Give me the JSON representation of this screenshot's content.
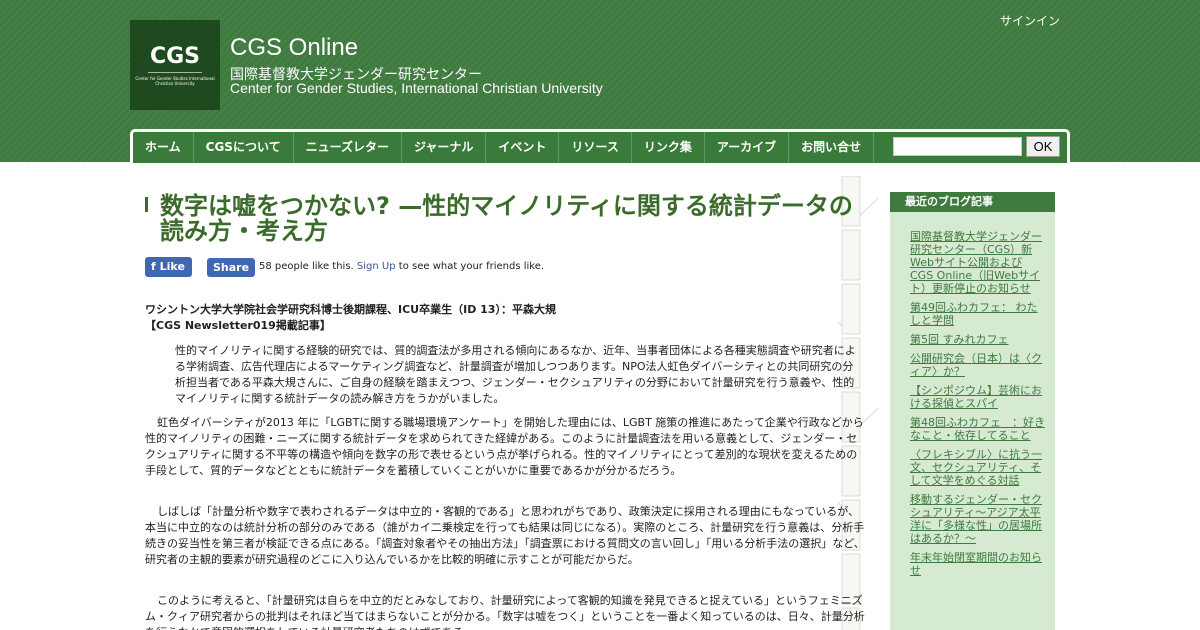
{
  "header": {
    "signin_label": "サインイン",
    "logo_text": "CGS",
    "logo_subtext": "Center for Gender Studies International Christian University",
    "site_title": "CGS Online",
    "desc_ja": "国際基督教大学ジェンダー研究センター",
    "desc_en": "Center for Gender Studies, International Christian University"
  },
  "nav": {
    "items": [
      "ホーム",
      "CGSについて",
      "ニューズレター",
      "ジャーナル",
      "イベント",
      "リソース",
      "リンク集",
      "アーカイブ",
      "お問い合せ"
    ],
    "search_placeholder": "",
    "search_button": "OK"
  },
  "post": {
    "title": "数字は嘘をつかない? —性的マイノリティに関する統計データの読み方・考え方",
    "fb_like": "Like",
    "fb_share": "Share",
    "fb_count_text": "58 people like this.",
    "fb_signup": "Sign Up",
    "fb_suffix": "to see what your friends like.",
    "author": "ワシントン大学大学院社会学研究科博士後期課程、ICU卒業生（ID 13）：平森大規",
    "newsletter": "【CGS Newsletter019掲載記事】",
    "quote": "性的マイノリティに関する経験的研究では、質的調査法が多用される傾向にあるなか、近年、当事者団体による各種実態調査や研究者による学術調査、広告代理店によるマーケティング調査など、計量調査が増加しつつあります。NPO法人虹色ダイバーシティとの共同研究の分析担当者である平森大規さんに、ご自身の経験を踏まえつつ、ジェンダー・セクシュアリティの分野において計量研究を行う意義や、性的マイノリティに関する統計データの読み解き方をうかがいました。",
    "paragraphs": [
      "虹色ダイバーシティが2013 年に「LGBTに関する職場環境アンケート」を開始した理由には、LGBT 施策の推進にあたって企業や行政などから性的マイノリティの困難・ニーズに関する統計データを求められてきた経緯がある。このように計量調査法を用いる意義として、ジェンダー・セクシュアリティに関する不平等の構造や傾向を数字の形で表せるという点が挙げられる。性的マイノリティにとって差別的な現状を変えるための手段として、質的データなどとともに統計データを蓄積していくことがいかに重要であるかが分かるだろう。",
      "しばしば「計量分析や数字で表わされるデータは中立的・客観的である」と思われがちであり、政策決定に採用される理由にもなっているが、本当に中立的なのは統計分析の部分のみである（誰がカイ二乗検定を行っても結果は同じになる）。実際のところ、計量研究を行う意義は、分析手続きの妥当性を第三者が検証できる点にある。「調査対象者やその抽出方法」「調査票における質問文の言い回し」「用いる分析手法の選択」など、研究者の主観的要素が研究過程のどこに入り込んでいるかを比較的明確に示すことが可能だからだ。",
      "このように考えると、「計量研究は自らを中立的だとみなしており、計量研究によって客観的知識を発見できると捉えている」というフェミニズム・クィア研究者からの批判はそれほど当てはまらないことが分かる。「数字は嘘をつく」ということを一番よく知っているのは、日々、計量分析を行うなかで意図的選択をしている計量研究者たちのはずである。"
    ]
  },
  "sidebar": {
    "title": "最近のブログ記事",
    "items": [
      "国際基督教大学ジェンダー研究センター（CGS）新Webサイト公開およびCGS Online（旧Webサイト）更新停止のお知らせ",
      "第49回ふわカフェ： わたしと学問",
      "第5回 すみれカフェ",
      "公開研究会（日本）は〈クィア〉か？",
      "【シンポジウム】芸術における探偵とスパイ",
      "第48回ふわカフェ　：好きなこと・依存してること",
      "〈フレキシブル〉に抗う一文、セクシュアリティ、そして文学をめぐる対話",
      "移動するジェンダー・セクシュアリティ～アジア太平洋に「多様な性」の居場所はあるか？～",
      "年末年始閉室期間のお知らせ"
    ]
  },
  "colors": {
    "header_green": "#3f7a3f",
    "title_green": "#3a6b2a",
    "sidebar_bg": "#d6ead2",
    "facebook_blue": "#4267b2"
  }
}
